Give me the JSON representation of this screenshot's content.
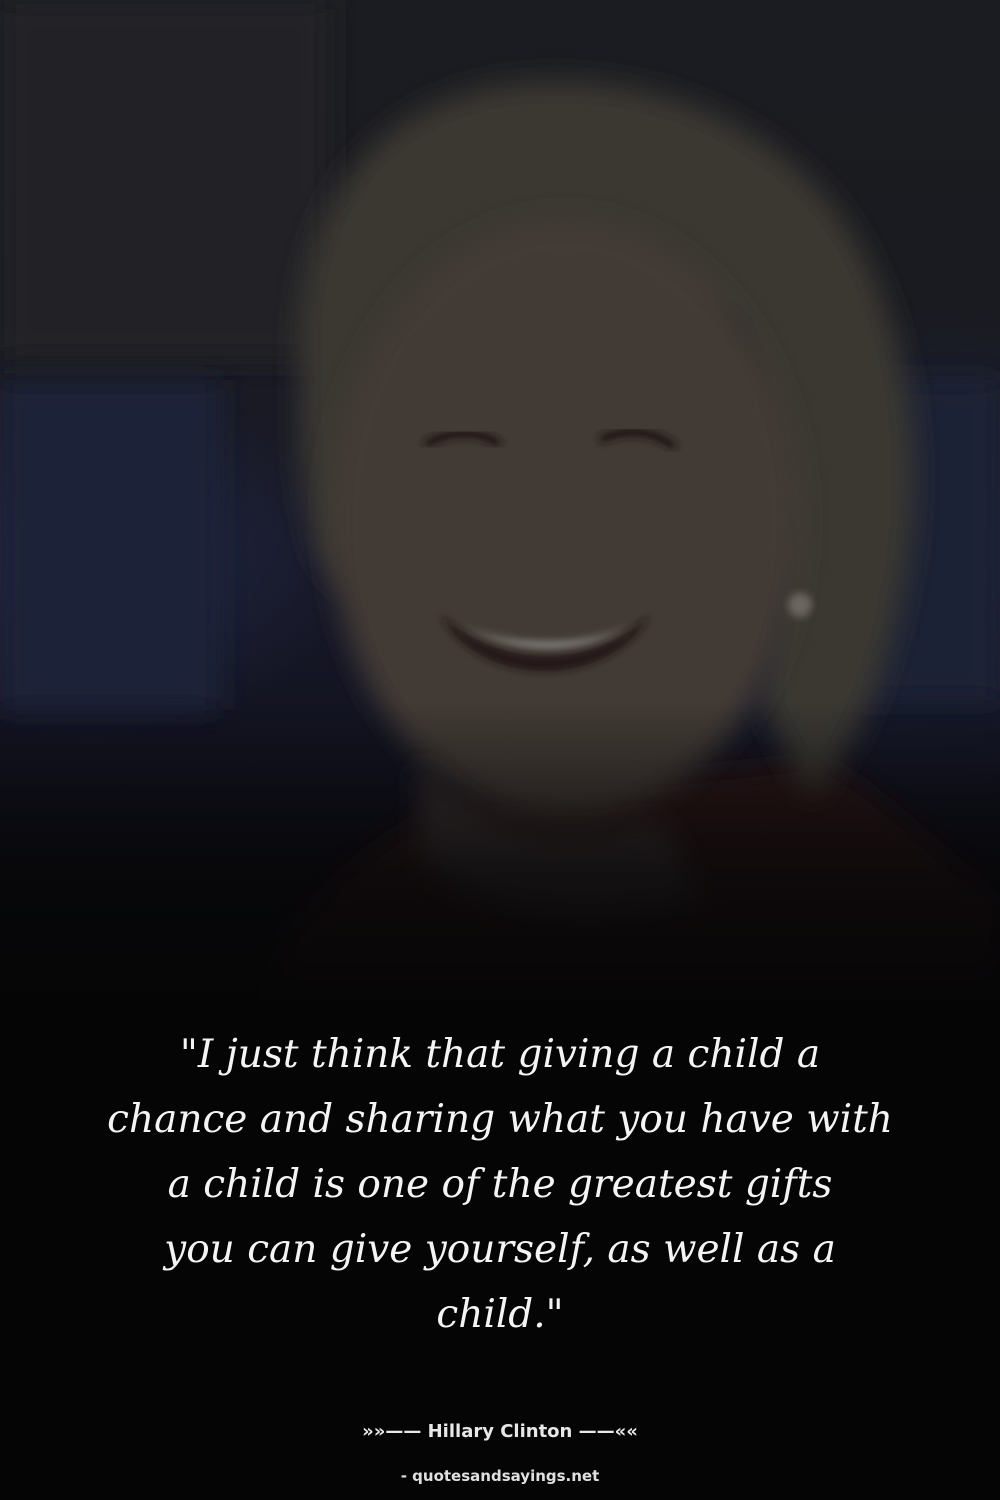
{
  "quote": {
    "lines": [
      "\"I just think that giving a child a",
      "chance and sharing what you have with",
      "a child is one of the greatest gifts",
      "you can give yourself, as well as a",
      "child.\""
    ]
  },
  "attribution": "»»—— Hillary Clinton ——««",
  "source": "- quotesandsayings.net",
  "colors": {
    "background": "#050506",
    "text": "#f4f4f4"
  }
}
